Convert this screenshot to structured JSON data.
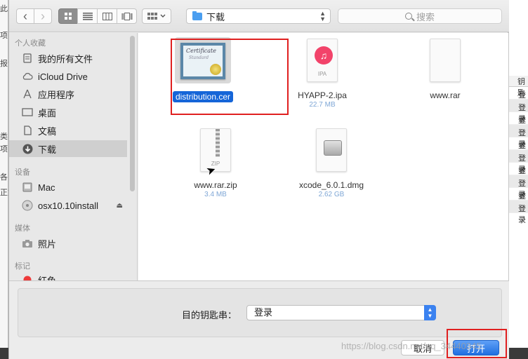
{
  "background_left_fragments": [
    "此电",
    "项目",
    "报记",
    "类",
    "项目",
    "各乙",
    "正式"
  ],
  "background_right": {
    "column_header": "钥匙",
    "cells": [
      "登录",
      "登录",
      "登录",
      "登录",
      "登录",
      "登录",
      "登录",
      "登录",
      "登录",
      "登录"
    ]
  },
  "toolbar": {
    "back_glyph": "‹",
    "forward_glyph": "›",
    "location": "下载",
    "search_placeholder": "搜索"
  },
  "sidebar": {
    "sections": [
      {
        "title": "个人收藏",
        "items": [
          {
            "label": "我的所有文件",
            "icon": "all-files-icon"
          },
          {
            "label": "iCloud Drive",
            "icon": "cloud-icon"
          },
          {
            "label": "应用程序",
            "icon": "applications-icon"
          },
          {
            "label": "桌面",
            "icon": "desktop-icon"
          },
          {
            "label": "文稿",
            "icon": "documents-icon"
          },
          {
            "label": "下载",
            "icon": "downloads-icon",
            "selected": true
          }
        ]
      },
      {
        "title": "设备",
        "items": [
          {
            "label": "Mac",
            "icon": "computer-icon"
          },
          {
            "label": "osx10.10install",
            "icon": "disk-icon",
            "eject": true
          }
        ]
      },
      {
        "title": "媒体",
        "items": [
          {
            "label": "照片",
            "icon": "camera-icon"
          }
        ]
      },
      {
        "title": "标记",
        "items": [
          {
            "label": "红色",
            "icon": "red-tag-icon"
          }
        ]
      }
    ]
  },
  "files": [
    {
      "name": "distribution.cer",
      "size": "",
      "type": "cer",
      "selected": true
    },
    {
      "name": "HYAPP-2.ipa",
      "size": "22.7 MB",
      "type": "ipa",
      "tag": "IPA"
    },
    {
      "name": "www.rar",
      "size": "",
      "type": "rar"
    },
    {
      "name": "www.rar.zip",
      "size": "3.4 MB",
      "type": "zip",
      "tag": "ZIP"
    },
    {
      "name": "xcode_6.0.1.dmg",
      "size": "2.62 GB",
      "type": "dmg"
    }
  ],
  "certificate_art": {
    "line1": "Certificate",
    "line2": "Standard"
  },
  "bottom": {
    "keychain_label": "目的钥匙串：",
    "keychain_value": "登录",
    "cancel_label": "取消",
    "open_label": "打开"
  },
  "watermark": "https://blog.csdn.net/qq_34440345",
  "colors": {
    "accent": "#1f6fe0",
    "selection": "#1565d8",
    "highlight_box": "#e02020"
  }
}
